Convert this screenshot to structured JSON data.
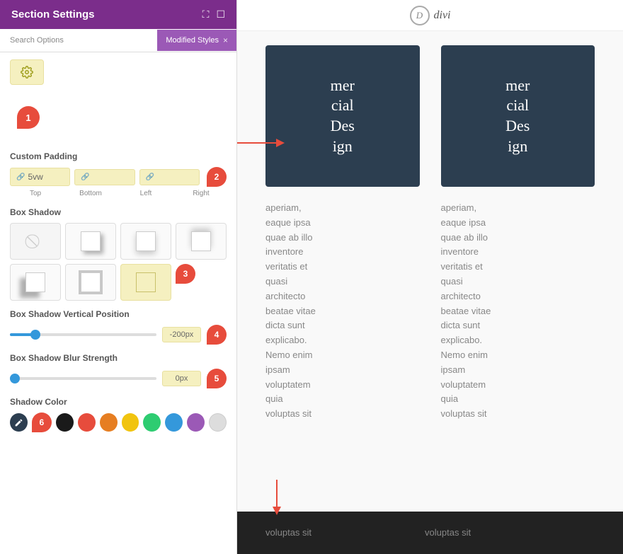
{
  "panel": {
    "title": "Section Settings",
    "search_label": "Search Options",
    "modified_styles_label": "Modified Styles",
    "close_label": "×"
  },
  "padding": {
    "label": "Custom Padding",
    "top_value": "5vw",
    "bottom_value": "",
    "left_value": "",
    "right_value": "",
    "top_label": "Top",
    "bottom_label": "Bottom",
    "left_label": "Left",
    "right_label": "Right"
  },
  "box_shadow": {
    "label": "Box Shadow"
  },
  "box_shadow_vertical": {
    "label": "Box Shadow Vertical Position",
    "value": "-200px"
  },
  "box_shadow_blur": {
    "label": "Box Shadow Blur Strength",
    "value": "0px"
  },
  "shadow_color": {
    "label": "Shadow Color"
  },
  "topbar": {
    "divi_letter": "D",
    "divi_text": "divi"
  },
  "annotations": {
    "badge1": "1",
    "badge2": "2",
    "badge3": "3",
    "badge4": "4",
    "badge5": "5",
    "badge6": "6"
  },
  "content": {
    "image_text": "mer\ncial\nDes\nign",
    "body_text": "aperiam,\neaque ipsa\nquae ab illo\ninventore\nveritatis et\nquasi\narchitecto\nbeatae vitae\ndicta sunt\nexplicabo.\nNemo enim\nipsam\nvoluptatem\nquia\nvoluptas sit"
  }
}
